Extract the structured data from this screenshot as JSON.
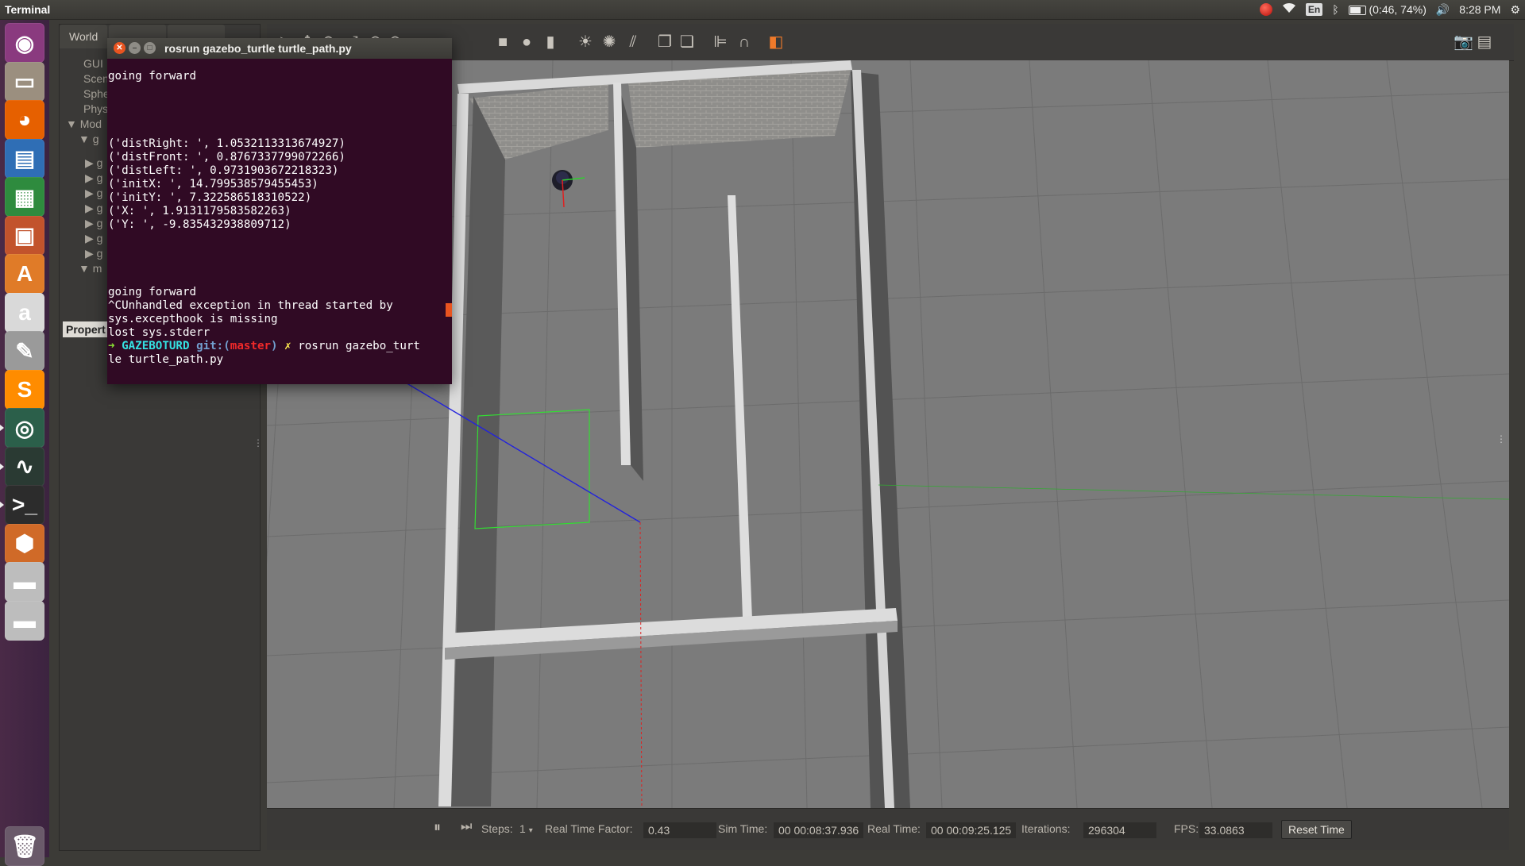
{
  "top_panel": {
    "app_title": "Terminal",
    "language": "En",
    "battery": "(0:46, 74%)",
    "battery_level": 0.74,
    "clock": "8:28 PM"
  },
  "launcher": {
    "items": [
      {
        "name": "ubuntu-dash-icon",
        "glyph": "◉",
        "color": "#8a3a7f"
      },
      {
        "name": "files-icon",
        "glyph": "▭",
        "color": "#9b8f7f"
      },
      {
        "name": "firefox-icon",
        "glyph": "◕",
        "color": "#e66000"
      },
      {
        "name": "writer-icon",
        "glyph": "▤",
        "color": "#2f6eb5"
      },
      {
        "name": "calc-icon",
        "glyph": "▦",
        "color": "#2e8b3e"
      },
      {
        "name": "impress-icon",
        "glyph": "▣",
        "color": "#c2532c"
      },
      {
        "name": "software-center-icon",
        "glyph": "A",
        "color": "#e07b28"
      },
      {
        "name": "amazon-icon",
        "glyph": "a",
        "color": "#d9d9d9"
      },
      {
        "name": "system-settings-icon",
        "glyph": "✎",
        "color": "#9a9a9a"
      },
      {
        "name": "sublime-text-icon",
        "glyph": "S",
        "color": "#ff8c00"
      },
      {
        "name": "gazebo-icon",
        "glyph": "◎",
        "color": "#2b5f4a"
      },
      {
        "name": "system-monitor-icon",
        "glyph": "∿",
        "color": "#2a3a33"
      },
      {
        "name": "terminal-icon",
        "glyph": ">_",
        "color": "#2c2c2c"
      },
      {
        "name": "software-updater-icon",
        "glyph": "⬢",
        "color": "#d06a28"
      },
      {
        "name": "drive-icon",
        "glyph": "▬",
        "color": "#bdbdbd"
      },
      {
        "name": "drive-icon-2",
        "glyph": "▬",
        "color": "#bdbdbd"
      },
      {
        "name": "trash-icon",
        "glyph": "🗑",
        "color": "#6a5a6a"
      }
    ]
  },
  "gazebo": {
    "tabs": [
      "World"
    ],
    "tree": [
      "GUI",
      "Scen",
      "Sphe",
      "Phys",
      "Mod",
      "g",
      "g",
      "g",
      "g",
      "g",
      "g",
      "g",
      "g",
      "m"
    ],
    "properties_label": "Propert",
    "bottom": {
      "steps_label": "Steps:",
      "steps_value": "1",
      "rtf_label": "Real Time Factor:",
      "rtf_value": "0.43",
      "sim_label": "Sim Time:",
      "sim_value": "00 00:08:37.936",
      "real_label": "Real Time:",
      "real_value": "00 00:09:25.125",
      "iter_label": "Iterations:",
      "iter_value": "296304",
      "fps_label": "FPS:",
      "fps_value": "33.0863",
      "reset_label": "Reset Time"
    }
  },
  "terminal": {
    "title": "rosrun gazebo_turtle turtle_path.py",
    "lines": [
      "going forward",
      "",
      "",
      "",
      "",
      "('distRight: ', 1.0532113313674927)",
      "('distFront: ', 0.8767337799072266)",
      "('distLeft: ', 0.9731903672218323)",
      "('initX: ', 14.799538579455453)",
      "('initY: ', 7.322586518310522)",
      "('X: ', 1.9131179583582263)",
      "('Y: ', -9.835432938809712)",
      "",
      "",
      "",
      "",
      "going forward",
      "^CUnhandled exception in thread started by",
      "sys.excepthook is missing",
      "lost sys.stderr"
    ],
    "prompt": {
      "arrow": "➜",
      "dir": "GAZEBOTURD",
      "git": "git:(",
      "branch": "master",
      "git_close": ")",
      "dirty": "✗",
      "command_line1": "rosrun gazebo_turt",
      "command_line2": "le turtle_path.py"
    }
  }
}
